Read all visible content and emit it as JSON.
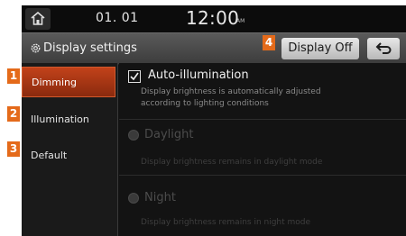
{
  "status_bar": {
    "date": "01. 01",
    "time": "12:00",
    "ampm": "AM"
  },
  "title_bar": {
    "title": "Display settings",
    "display_off_label": "Display Off"
  },
  "sidebar": {
    "items": [
      {
        "label": "Dimming",
        "badge": "1",
        "active": true
      },
      {
        "label": "Illumination",
        "badge": "2",
        "active": false
      },
      {
        "label": "Default",
        "badge": "3",
        "active": false
      }
    ]
  },
  "callout_badge_4": "4",
  "content": {
    "auto_illumination": {
      "label": "Auto-illumination",
      "checked": true,
      "description_line1": "Display brightness is automatically adjusted",
      "description_line2": "according to lighting conditions"
    },
    "daylight": {
      "label": "Daylight",
      "description": "Display brightness remains in daylight mode"
    },
    "night": {
      "label": "Night",
      "description": "Display brightness remains in night mode"
    }
  },
  "colors": {
    "accent": "#c2421a",
    "badge": "#e46a1a"
  },
  "icons": {
    "home": "home-icon",
    "settings": "gear-icon",
    "back": "back-arrow-icon"
  }
}
